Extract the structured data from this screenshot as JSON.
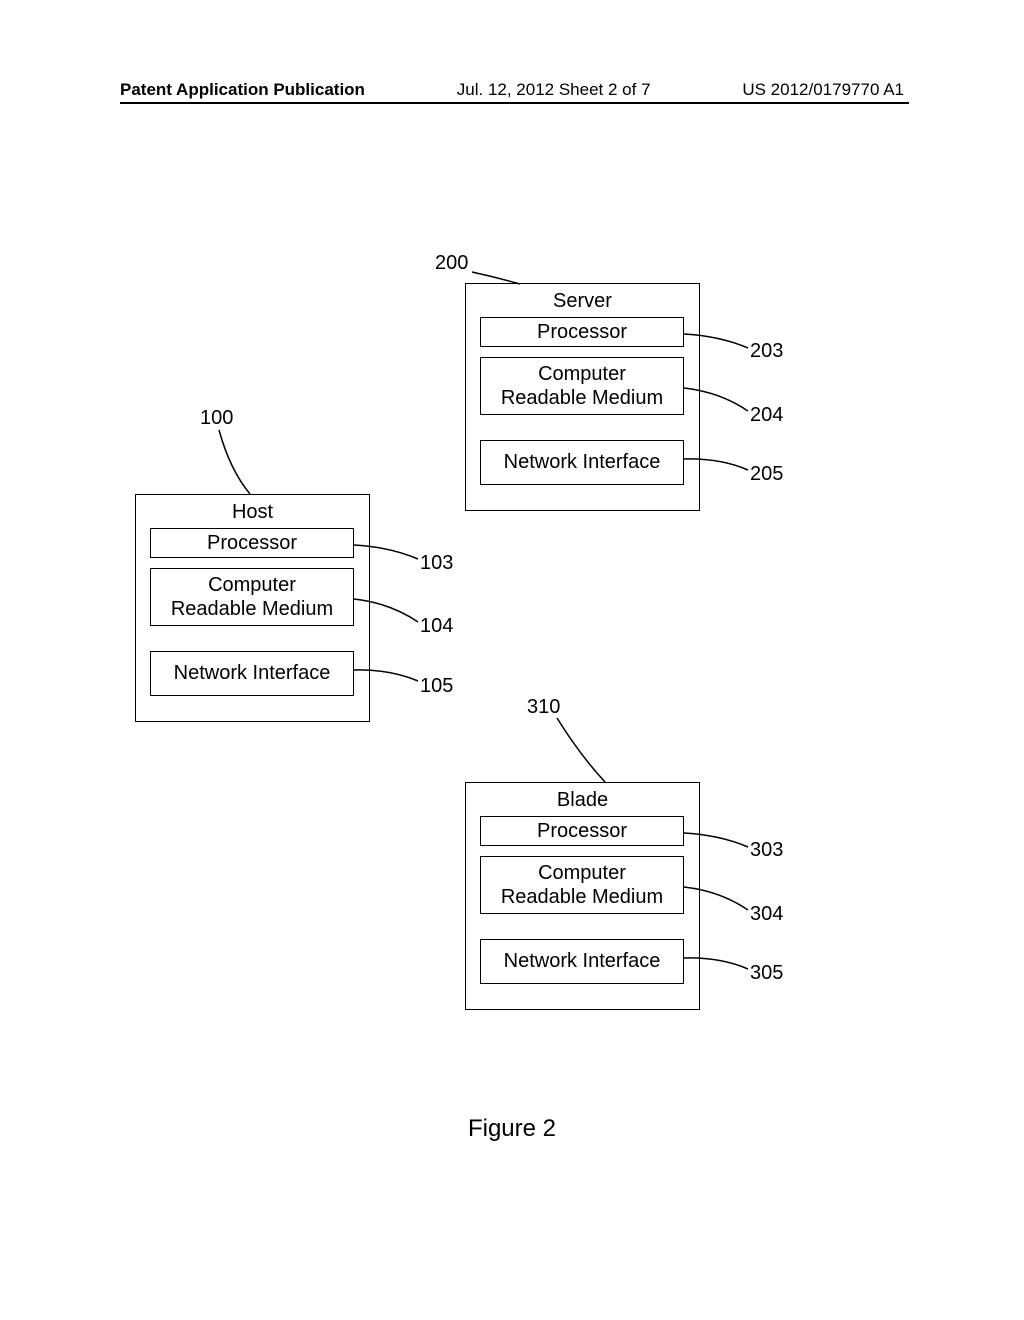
{
  "header": {
    "left": "Patent Application Publication",
    "center": "Jul. 12, 2012  Sheet 2 of 7",
    "right": "US 2012/0179770 A1"
  },
  "blocks": {
    "server": {
      "ref": "200",
      "title": "Server",
      "processor": "Processor",
      "processor_ref": "203",
      "medium": "Computer\nReadable Medium",
      "medium_ref": "204",
      "interface": "Network Interface",
      "interface_ref": "205"
    },
    "host": {
      "ref": "100",
      "title": "Host",
      "processor": "Processor",
      "processor_ref": "103",
      "medium": "Computer\nReadable Medium",
      "medium_ref": "104",
      "interface": "Network Interface",
      "interface_ref": "105"
    },
    "blade": {
      "ref": "310",
      "title": "Blade",
      "processor": "Processor",
      "processor_ref": "303",
      "medium": "Computer\nReadable Medium",
      "medium_ref": "304",
      "interface": "Network Interface",
      "interface_ref": "305"
    }
  },
  "figure_caption": "Figure 2"
}
